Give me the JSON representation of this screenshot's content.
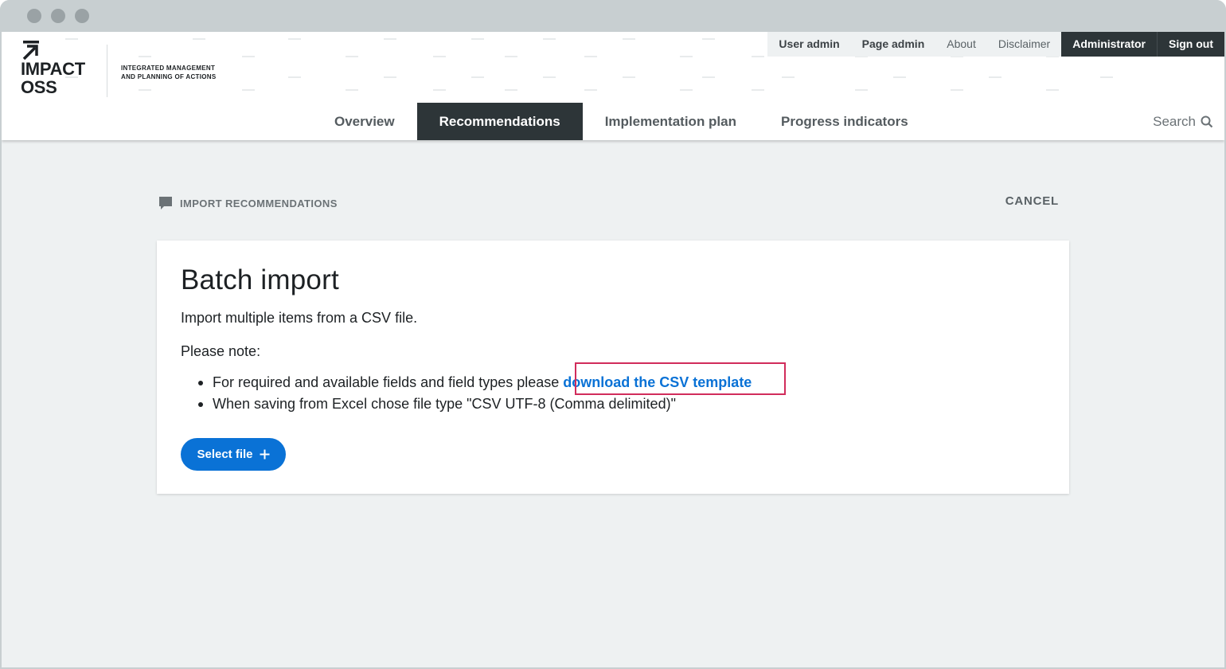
{
  "logo": {
    "text_line1": "IMPACT",
    "text_line2": "OSS",
    "tagline_line1": "INTEGRATED MANAGEMENT",
    "tagline_line2": "AND PLANNING OF ACTIONS"
  },
  "topnav": {
    "items": [
      {
        "label": "User admin"
      },
      {
        "label": "Page admin"
      },
      {
        "label": "About"
      },
      {
        "label": "Disclaimer"
      },
      {
        "label": "Administrator"
      },
      {
        "label": "Sign out"
      }
    ]
  },
  "mainnav": {
    "tabs": [
      {
        "label": "Overview"
      },
      {
        "label": "Recommendations",
        "active": true
      },
      {
        "label": "Implementation plan"
      },
      {
        "label": "Progress indicators"
      }
    ],
    "search_label": "Search",
    "search_icon": "search-icon"
  },
  "page": {
    "section_label": "IMPORT RECOMMENDATIONS",
    "section_icon": "speech-bubble-icon",
    "cancel_label": "CANCEL"
  },
  "card": {
    "title": "Batch import",
    "intro": "Import multiple items from a CSV file.",
    "note_heading": "Please note:",
    "bullet1_prefix": "For required and available fields and field types please",
    "bullet1_link": "download the CSV template",
    "bullet2": "When saving from Excel chose file type \"CSV UTF-8 (Comma delimited)\"",
    "button_label": "Select file",
    "button_icon": "plus-icon"
  },
  "colors": {
    "accent": "#0a72d6",
    "nav_dark": "#2d3538",
    "highlight": "#d12c5b",
    "page_bg": "#eef1f2"
  }
}
